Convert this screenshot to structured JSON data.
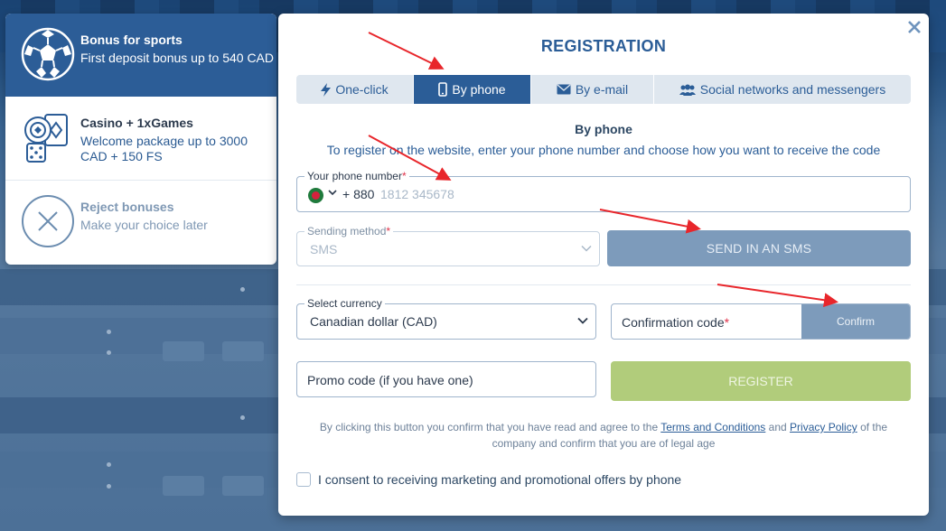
{
  "bonus_panel": {
    "sports": {
      "title": "Bonus for sports",
      "desc": "First deposit bonus up to 540 CAD",
      "icon": "soccer-ball-icon"
    },
    "casino": {
      "title": "Casino + 1xGames",
      "desc": "Welcome package up to 3000 CAD + 150 FS",
      "icon": "casino-chips-cards-icon"
    },
    "reject": {
      "title": "Reject bonuses",
      "desc": "Make your choice later",
      "icon": "reject-x-icon"
    }
  },
  "modal": {
    "title": "REGISTRATION",
    "tabs": [
      {
        "label": "One-click",
        "icon": "lightning-icon"
      },
      {
        "label": "By phone",
        "icon": "phone-icon",
        "active": true
      },
      {
        "label": "By e-mail",
        "icon": "envelope-icon"
      },
      {
        "label": "Social networks and messengers",
        "icon": "people-icon"
      }
    ],
    "section_title": "By phone",
    "section_desc": "To register on the website, enter your phone number and choose how you want to receive the code",
    "phone": {
      "label": "Your phone number",
      "code": "+ 880",
      "placeholder": "1812 345678"
    },
    "sending_method": {
      "label": "Sending method",
      "value": "SMS"
    },
    "send_sms_label": "SEND IN AN SMS",
    "currency": {
      "label": "Select currency",
      "value": "Canadian dollar (CAD)"
    },
    "confirmation": {
      "label": "Confirmation code",
      "button": "Confirm"
    },
    "promo": {
      "placeholder": "Promo code (if you have one)"
    },
    "register_label": "REGISTER",
    "terms": {
      "prefix": "By clicking this button you confirm that you have read and agree to the",
      "terms_link": "Terms and Conditions",
      "and": "and",
      "privacy_link": "Privacy Policy",
      "suffix": "of the company and confirm that you are of legal age"
    },
    "consent": "I consent to receiving marketing and promotional offers by phone"
  },
  "colors": {
    "primary": "#2b5d97",
    "button_disabled": "#7d9bbb",
    "register": "#b1cc7b",
    "required": "#e0324a",
    "annotation_arrow": "#e8262b"
  }
}
